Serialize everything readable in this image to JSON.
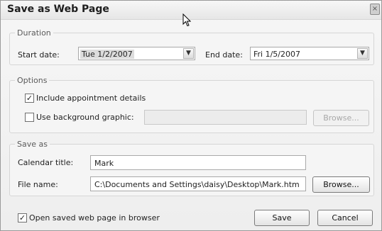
{
  "dialog": {
    "title": "Save as Web Page",
    "close_glyph": "×"
  },
  "duration": {
    "legend": "Duration",
    "start_label": "Start date:",
    "start_value": "Tue 1/2/2007",
    "end_label": "End date:",
    "end_value": "Fri 1/5/2007",
    "dropdown_glyph": "▼"
  },
  "options": {
    "legend": "Options",
    "include_details_label": "Include appointment details",
    "include_details_checked": true,
    "background_label": "Use background graphic:",
    "background_checked": false,
    "background_path": "",
    "browse_label": "Browse..."
  },
  "save_as": {
    "legend": "Save as",
    "calendar_title_label": "Calendar title:",
    "calendar_title_value": "Mark",
    "file_name_label": "File name:",
    "file_name_value": "C:\\Documents and Settings\\daisy\\Desktop\\Mark.htm",
    "browse_label": "Browse..."
  },
  "footer": {
    "open_in_browser_label": "Open saved web page in browser",
    "open_in_browser_checked": true,
    "save_label": "Save",
    "cancel_label": "Cancel"
  },
  "check_glyph": "✓"
}
